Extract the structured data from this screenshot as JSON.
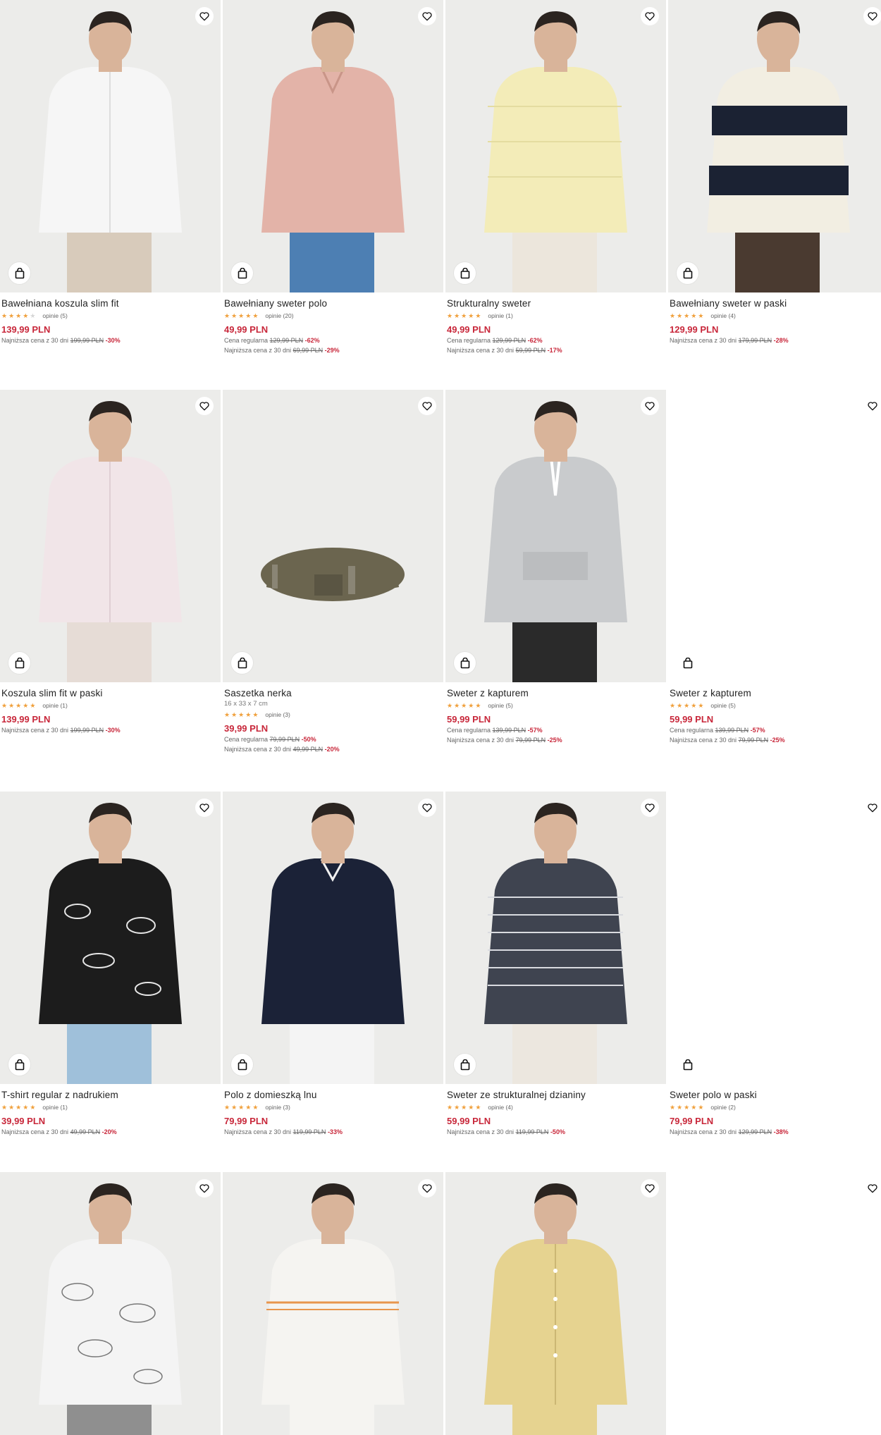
{
  "colors": {
    "sale": "#c8273a",
    "star": "#f0a03c",
    "text": "#222222"
  },
  "icons": {
    "favorite": "heart-outline-icon",
    "cart": "shopping-bag-icon"
  },
  "products": [
    {
      "name": "Bawełniana koszula slim fit",
      "stars": 4,
      "reviews": "opinie (5)",
      "price": "139,99 PLN",
      "history": [
        {
          "label": "Najniższa cena z 30 dni",
          "old": "199,99 PLN",
          "pct": "-30%"
        }
      ]
    },
    {
      "name": "Bawełniany sweter polo",
      "stars": 4.5,
      "reviews": "opinie (20)",
      "price": "49,99 PLN",
      "history": [
        {
          "label": "Cena regularna",
          "old": "129,99 PLN",
          "pct": "-62%"
        },
        {
          "label": "Najniższa cena z 30 dni",
          "old": "69,99 PLN",
          "pct": "-29%"
        }
      ]
    },
    {
      "name": "Strukturalny sweter",
      "stars": 5,
      "reviews": "opinie (1)",
      "price": "49,99 PLN",
      "history": [
        {
          "label": "Cena regularna",
          "old": "129,99 PLN",
          "pct": "-62%"
        },
        {
          "label": "Najniższa cena z 30 dni",
          "old": "59,99 PLN",
          "pct": "-17%"
        }
      ]
    },
    {
      "name": "Bawełniany sweter w paski",
      "stars": 5,
      "reviews": "opinie (4)",
      "price": "129,99 PLN",
      "history": [
        {
          "label": "Najniższa cena z 30 dni",
          "old": "179,99 PLN",
          "pct": "-28%"
        }
      ]
    },
    {
      "name": "Koszula slim fit w paski",
      "stars": 5,
      "reviews": "opinie (1)",
      "price": "139,99 PLN",
      "history": [
        {
          "label": "Najniższa cena z 30 dni",
          "old": "199,99 PLN",
          "pct": "-30%"
        }
      ]
    },
    {
      "name": "Saszetka nerka",
      "size": "16 x 33 x 7 cm",
      "stars": 4.5,
      "reviews": "opinie (3)",
      "price": "39,99 PLN",
      "history": [
        {
          "label": "Cena regularna",
          "old": "79,99 PLN",
          "pct": "-50%"
        },
        {
          "label": "Najniższa cena z 30 dni",
          "old": "49,99 PLN",
          "pct": "-20%"
        }
      ]
    },
    {
      "name": "Sweter z kapturem",
      "stars": 5,
      "reviews": "opinie (5)",
      "price": "59,99 PLN",
      "history": [
        {
          "label": "Cena regularna",
          "old": "139,99 PLN",
          "pct": "-57%"
        },
        {
          "label": "Najniższa cena z 30 dni",
          "old": "79,99 PLN",
          "pct": "-25%"
        }
      ]
    },
    {
      "name": "Sweter z kapturem",
      "stars": 5,
      "reviews": "opinie (5)",
      "price": "59,99 PLN",
      "blank": true,
      "history": [
        {
          "label": "Cena regularna",
          "old": "139,99 PLN",
          "pct": "-57%"
        },
        {
          "label": "Najniższa cena z 30 dni",
          "old": "79,99 PLN",
          "pct": "-25%"
        }
      ]
    },
    {
      "name": "T-shirt regular z nadrukiem",
      "stars": 5,
      "reviews": "opinie (1)",
      "price": "39,99 PLN",
      "history": [
        {
          "label": "Najniższa cena z 30 dni",
          "old": "49,99 PLN",
          "pct": "-20%"
        }
      ]
    },
    {
      "name": "Polo z domieszką lnu",
      "stars": 5,
      "reviews": "opinie (3)",
      "price": "79,99 PLN",
      "history": [
        {
          "label": "Najniższa cena z 30 dni",
          "old": "119,99 PLN",
          "pct": "-33%"
        }
      ]
    },
    {
      "name": "Sweter ze strukturalnej dzianiny",
      "stars": 5,
      "reviews": "opinie (4)",
      "price": "59,99 PLN",
      "history": [
        {
          "label": "Najniższa cena z 30 dni",
          "old": "119,99 PLN",
          "pct": "-50%"
        }
      ]
    },
    {
      "name": "Sweter polo w paski",
      "stars": 5,
      "reviews": "opinie (2)",
      "price": "79,99 PLN",
      "blank": true,
      "history": [
        {
          "label": "Najniższa cena z 30 dni",
          "old": "129,99 PLN",
          "pct": "-38%"
        }
      ]
    },
    {
      "image_only": true
    },
    {
      "image_only": true
    },
    {
      "image_only": true
    },
    {
      "image_only": true,
      "blank": true
    }
  ]
}
